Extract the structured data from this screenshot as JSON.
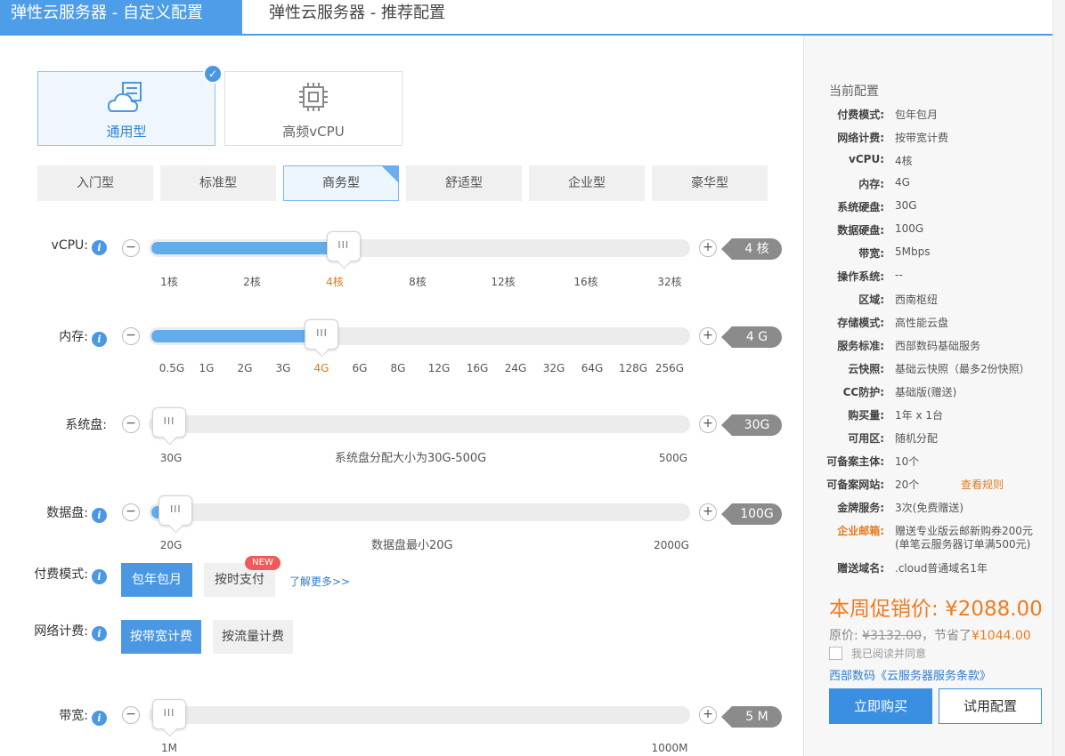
{
  "tabs": [
    "弹性云服务器 - 自定义配置",
    "弹性云服务器 - 推荐配置"
  ],
  "categories": [
    {
      "label": "通用型",
      "icon": "cloud-server-icon",
      "selected": true
    },
    {
      "label": "高频vCPU",
      "icon": "cpu-chip-icon",
      "selected": false
    }
  ],
  "tiers": [
    "入门型",
    "标准型",
    "商务型",
    "舒适型",
    "企业型",
    "豪华型"
  ],
  "selected_tier": "商务型",
  "sliders": {
    "vcpu": {
      "label": "vCPU:",
      "value": "4 核",
      "ticks": [
        "1核",
        "2核",
        "4核",
        "8核",
        "12核",
        "16核",
        "32核"
      ],
      "active_tick": "4核",
      "fraction": 0.35
    },
    "memory": {
      "label": "内存:",
      "value": "4 G",
      "ticks": [
        "0.5G",
        "1G",
        "2G",
        "3G",
        "4G",
        "6G",
        "8G",
        "12G",
        "16G",
        "24G",
        "32G",
        "64G",
        "128G",
        "256G"
      ],
      "active_tick": "4G",
      "fraction": 0.31
    },
    "system_disk": {
      "label": "系统盘:",
      "value": "30G",
      "min": "30G",
      "max": "500G",
      "note": "系统盘分配大小为30G-500G",
      "fraction": 0.0
    },
    "data_disk": {
      "label": "数据盘:",
      "value": "100G",
      "min": "20G",
      "max": "2000G",
      "note": "数据盘最小20G",
      "fraction": 0.04
    },
    "bandwidth": {
      "label": "带宽:",
      "value": "5 M",
      "min": "1M",
      "max": "1000M",
      "fraction": 0.0
    }
  },
  "payment": {
    "label": "付费模式:",
    "options": [
      "包年包月",
      "按时支付"
    ],
    "badge": "NEW",
    "link": "了解更多>>"
  },
  "network": {
    "label": "网络计费:",
    "options": [
      "按带宽计费",
      "按流量计费"
    ]
  },
  "summary": {
    "title": "当前配置",
    "rows": [
      {
        "k": "付费模式:",
        "v": "包年包月"
      },
      {
        "k": "网络计费:",
        "v": "按带宽计费"
      },
      {
        "k": "vCPU:",
        "v": "4核"
      },
      {
        "k": "内存:",
        "v": "4G"
      },
      {
        "k": "系统硬盘:",
        "v": "30G"
      },
      {
        "k": "数据硬盘:",
        "v": "100G"
      },
      {
        "k": "带宽:",
        "v": "5Mbps"
      },
      {
        "k": "操作系统:",
        "v": "--"
      },
      {
        "k": "区域:",
        "v": "西南枢纽"
      },
      {
        "k": "存储模式:",
        "v": "高性能云盘"
      },
      {
        "k": "服务标准:",
        "v": "西部数码基础服务"
      },
      {
        "k": "云快照:",
        "v": "基础云快照（最多2份快照）"
      },
      {
        "k": "CC防护:",
        "v": "基础版(赠送)"
      },
      {
        "k": "购买量:",
        "v": "1年 x 1台"
      },
      {
        "k": "可用区:",
        "v": "随机分配"
      },
      {
        "k": "可备案主体:",
        "v": "10个"
      },
      {
        "k": "可备案网站:",
        "v": "20个",
        "extra": "查看规则"
      },
      {
        "k": "金牌服务:",
        "v": "3次(免费赠送)"
      },
      {
        "k": "企业邮箱:",
        "v": "赠送专业版云邮新购券200元",
        "v2": "(单笔云服务器订单满500元)"
      },
      {
        "k": "赠送域名:",
        "v": ".cloud普通域名1年"
      }
    ],
    "promo_label": "本周促销价:",
    "promo_price": "¥2088.00",
    "orig_label": "原价:",
    "orig_price": "¥3132.00",
    "save_label": "，节省了",
    "save_amount": "¥1044.00",
    "agree_text": "我已阅读并同意",
    "terms_text": "西部数码《云服务器服务条款》",
    "buy_label": "立即购买",
    "trial_label": "试用配置"
  },
  "colors": {
    "accent": "#4a97e3",
    "orange": "#f07b1e"
  }
}
